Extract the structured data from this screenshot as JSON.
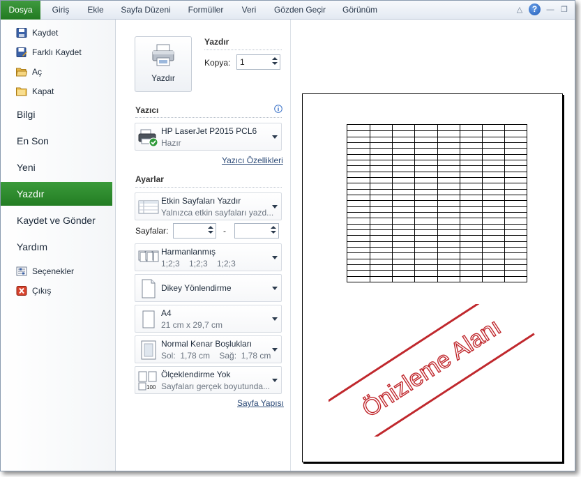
{
  "ribbon": {
    "tabs": [
      "Dosya",
      "Giriş",
      "Ekle",
      "Sayfa Düzeni",
      "Formüller",
      "Veri",
      "Gözden Geçir",
      "Görünüm"
    ],
    "controls": {
      "minimize_ribbon": "△",
      "help": "?",
      "minimize": "—",
      "restore": "❐"
    }
  },
  "nav": {
    "small_top": [
      {
        "label": "Kaydet",
        "icon": "save-icon"
      },
      {
        "label": "Farklı Kaydet",
        "icon": "save-as-icon"
      },
      {
        "label": "Aç",
        "icon": "open-folder-icon"
      },
      {
        "label": "Kapat",
        "icon": "close-folder-icon"
      }
    ],
    "big": [
      "Bilgi",
      "En Son",
      "Yeni",
      "Yazdır",
      "Kaydet ve Gönder",
      "Yardım"
    ],
    "active": "Yazdır",
    "small_bottom": [
      {
        "label": "Seçenekler",
        "icon": "options-icon"
      },
      {
        "label": "Çıkış",
        "icon": "exit-icon"
      }
    ]
  },
  "print": {
    "button_label": "Yazdır",
    "title": "Yazdır",
    "copies_label": "Kopya:",
    "copies_value": "1"
  },
  "printer": {
    "section": "Yazıcı",
    "name": "HP LaserJet P2015 PCL6",
    "status": "Hazır",
    "properties_link": "Yazıcı Özellikleri"
  },
  "settings": {
    "section": "Ayarlar",
    "what": {
      "title": "Etkin Sayfaları Yazdır",
      "sub": "Yalnızca etkin sayfaları yazd..."
    },
    "pages_label": "Sayfalar:",
    "pages_dash": "-",
    "collate": {
      "title": "Harmanlanmış",
      "sub": "1;2;3    1;2;3    1;2;3"
    },
    "orientation": {
      "title": "Dikey Yönlendirme"
    },
    "paper": {
      "title": "A4",
      "sub": "21 cm x 29,7 cm"
    },
    "margins": {
      "title": "Normal Kenar Boşlukları",
      "sub": "Sol:  1,78 cm    Sağ:  1,78 cm"
    },
    "scaling": {
      "title": "Ölçeklendirme Yok",
      "sub": "Sayfaları gerçek boyutunda..."
    },
    "page_setup_link": "Sayfa Yapısı"
  },
  "preview": {
    "stamp_text": "Önizleme Alanı",
    "grid_rows": 27,
    "grid_cols": 8
  },
  "colors": {
    "accent": "#2a8a2a",
    "stamp": "#c0282d"
  }
}
